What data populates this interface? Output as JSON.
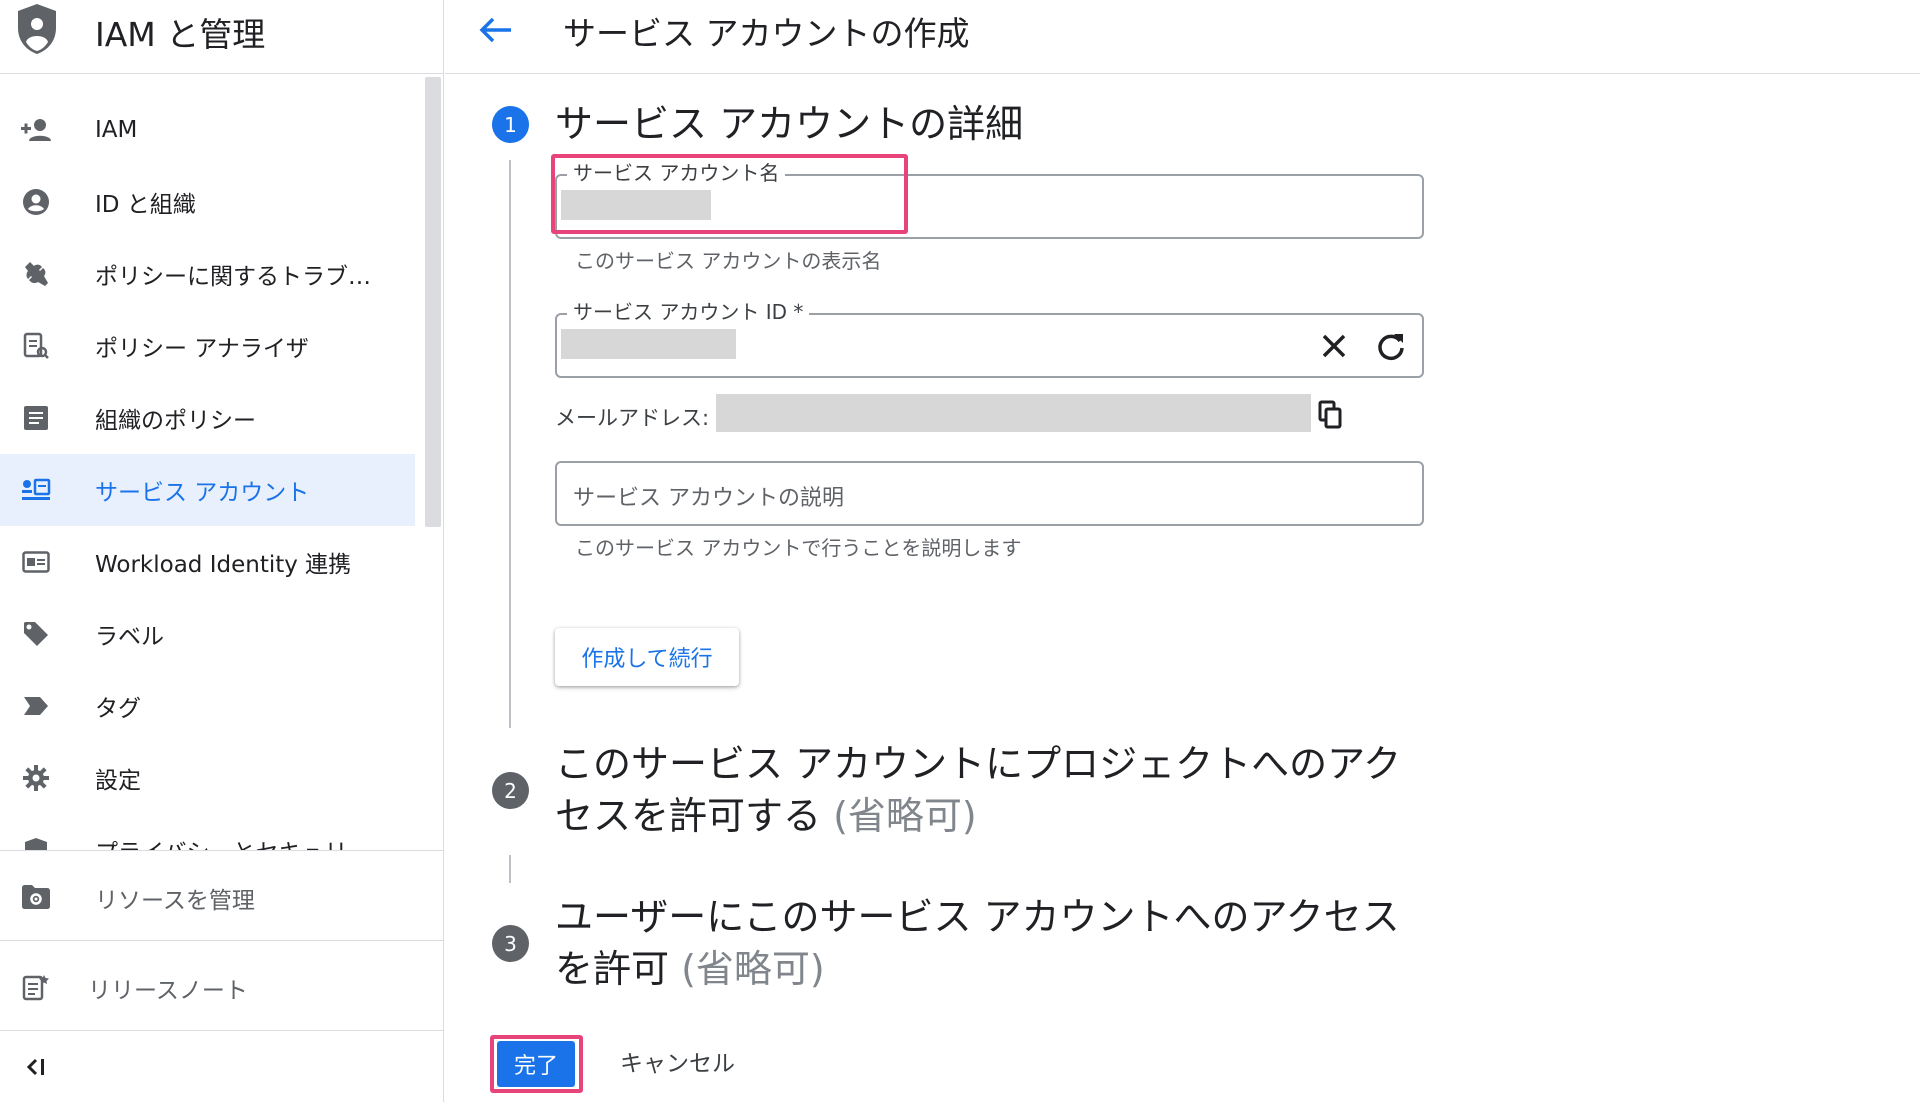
{
  "sidebar": {
    "title": "IAM と管理",
    "items": [
      {
        "label": "IAM",
        "icon": "person-add-icon"
      },
      {
        "label": "ID と組織",
        "icon": "account-circle-icon"
      },
      {
        "label": "ポリシーに関するトラブ…",
        "icon": "wrench-icon"
      },
      {
        "label": "ポリシー アナライザ",
        "icon": "policy-analyzer-icon"
      },
      {
        "label": "組織のポリシー",
        "icon": "list-document-icon"
      },
      {
        "label": "サービス アカウント",
        "icon": "service-account-icon",
        "active": true
      },
      {
        "label": "Workload Identity 連携",
        "icon": "id-card-icon"
      },
      {
        "label": "ラベル",
        "icon": "tag-icon"
      },
      {
        "label": "タグ",
        "icon": "chevron-tag-icon"
      },
      {
        "label": "設定",
        "icon": "gear-icon"
      },
      {
        "label": "プライバシーとセキュリ",
        "icon": "shield-icon"
      }
    ],
    "manage_resources": "リソースを管理",
    "release_notes": "リリースノート",
    "collapse_icon": "collapse-icon"
  },
  "header": {
    "title": "サービス アカウントの作成"
  },
  "steps": [
    {
      "number": "1",
      "title": "サービス アカウントの詳細"
    },
    {
      "number": "2",
      "title": "このサービス アカウントにプロジェクトへのアクセスを許可する",
      "optional": "(省略可)"
    },
    {
      "number": "3",
      "title": "ユーザーにこのサービス アカウントへのアクセスを許可",
      "optional": "(省略可)"
    }
  ],
  "form": {
    "name_label": "サービス アカウント名",
    "name_hint": "このサービス アカウントの表示名",
    "id_label": "サービス アカウント ID *",
    "email_label": "メールアドレス:",
    "description_placeholder": "サービス アカウントの説明",
    "description_hint": "このサービス アカウントで行うことを説明します",
    "create_continue": "作成して続行"
  },
  "footer": {
    "done": "完了",
    "cancel": "キャンセル"
  },
  "colors": {
    "accent": "#1a73e8",
    "highlight": "#e8447a"
  }
}
